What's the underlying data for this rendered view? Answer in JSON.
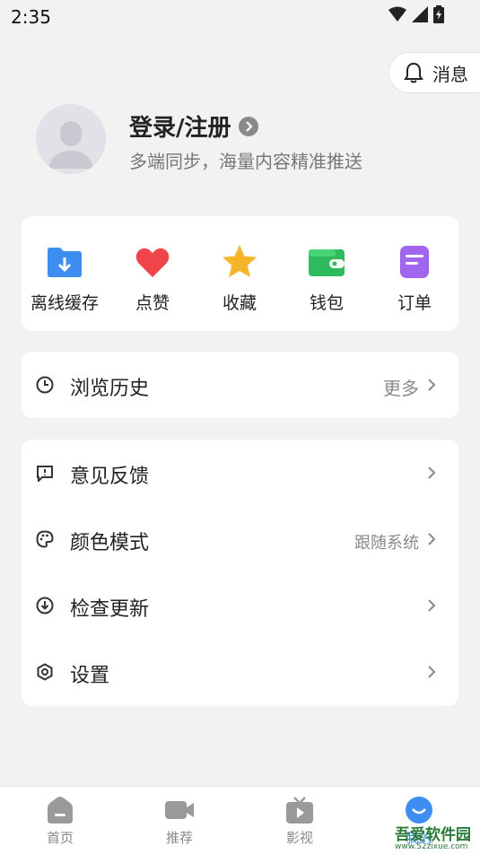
{
  "status_bar": {
    "time": "2:35"
  },
  "header": {
    "messages_label": "消息"
  },
  "profile": {
    "login_title": "登录/注册",
    "subtitle": "多端同步，海量内容精准推送"
  },
  "quick_actions": [
    {
      "label": "离线缓存",
      "icon": "download-folder-icon",
      "color": "#3d8ef0"
    },
    {
      "label": "点赞",
      "icon": "heart-icon",
      "color": "#f0444a"
    },
    {
      "label": "收藏",
      "icon": "star-icon",
      "color": "#f5b52a"
    },
    {
      "label": "钱包",
      "icon": "wallet-icon",
      "color": "#2dbb5d"
    },
    {
      "label": "订单",
      "icon": "order-icon",
      "color": "#a066f0"
    }
  ],
  "history": {
    "label": "浏览历史",
    "more": "更多"
  },
  "settings_list": [
    {
      "label": "意见反馈",
      "value": "",
      "icon": "feedback-icon"
    },
    {
      "label": "颜色模式",
      "value": "跟随系统",
      "icon": "palette-icon"
    },
    {
      "label": "检查更新",
      "value": "",
      "icon": "update-icon"
    },
    {
      "label": "设置",
      "value": "",
      "icon": "settings-icon"
    }
  ],
  "tabs": [
    {
      "label": "首页",
      "icon": "home-icon"
    },
    {
      "label": "推荐",
      "icon": "video-camera-icon"
    },
    {
      "label": "影视",
      "icon": "tv-icon"
    },
    {
      "label": "我的",
      "icon": "profile-icon",
      "active": true
    }
  ],
  "watermark": {
    "title": "吾爱软件园",
    "url": "www.52zixue.com"
  }
}
